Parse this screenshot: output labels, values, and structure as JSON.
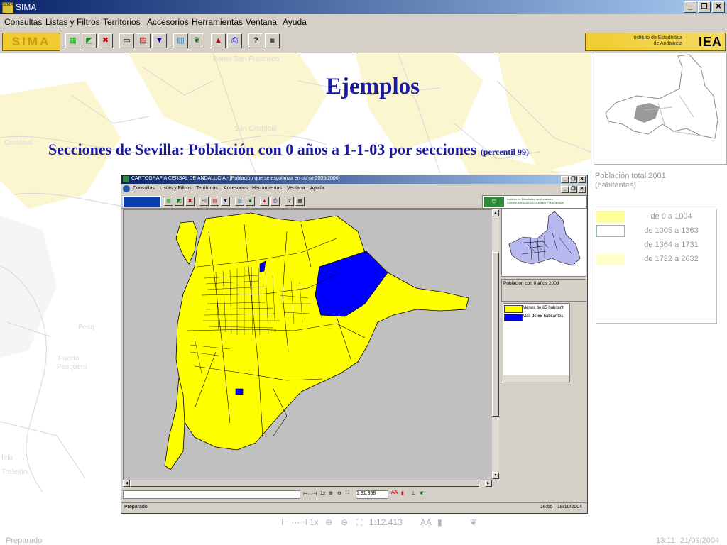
{
  "window": {
    "title": "SIMA",
    "app_icon_text": "SIMA",
    "minimize": "_",
    "restore": "❐",
    "close": "✕"
  },
  "menu": [
    "Consultas",
    "Listas y Filtros",
    "Territorios",
    "Accesorios",
    "Herramientas",
    "Ventana",
    "Ayuda"
  ],
  "toolbar": {
    "logo_text": "SIMA",
    "ieal_line1": "Instituto de Estadística",
    "ieal_line2": "de Andalucía",
    "iea_text": "IEA"
  },
  "slide": {
    "title": "Ejemplos",
    "subtitle": "Secciones de Sevilla: Población con 0 años a 1-1-03 por secciones",
    "subtitle_note": "(percentil 99)"
  },
  "side_legend": {
    "label_line1": "Población total 2001",
    "label_line2": "(habitantes)",
    "items": [
      {
        "label": "de 0 a 1004",
        "color": "#ffff99"
      },
      {
        "label": "de 1005 a 1363",
        "color": "#ffffff"
      },
      {
        "label": "de 1364 a 1731",
        "color": "#ffffff"
      },
      {
        "label": "de 1732 a 2632",
        "color": "#ffffcc"
      }
    ]
  },
  "inner_window": {
    "title": "CARTOGRAFÍA CENSAL DE ANDALUCÍA - [Población que se escolariza en curso 2005/2006]",
    "menu": [
      "Consultas",
      "Listas y Filtros",
      "Territorios",
      "Accesorios",
      "Herramientas",
      "Ventana",
      "Ayuda"
    ],
    "logo_line1": "Instituto de Estadística de Andalucía",
    "logo_line2": "CONSEJERÍA DE ECONOMÍA Y HACIENDA",
    "layer_name": "Población con 0 años 2003",
    "legend": [
      {
        "label": "Menos de 65 habitant",
        "color": "#ffff00"
      },
      {
        "label": "Más de 65 habitantes",
        "color": "#0000ff"
      }
    ],
    "scale": "1:91.358",
    "zoom": "1x",
    "status": "Preparado",
    "time": "16:55",
    "date": "18/10/2004"
  },
  "outer_bottom": {
    "zoom": "1x",
    "scale": "1:12.413"
  },
  "status": {
    "text": "Preparado",
    "time": "13:11",
    "date": "21/09/2004"
  },
  "colors": {
    "title_blue": "#1a1aa0",
    "map_yellow": "#ffff00",
    "map_blue": "#0000ff",
    "map_bg": "#c0c0c0"
  }
}
